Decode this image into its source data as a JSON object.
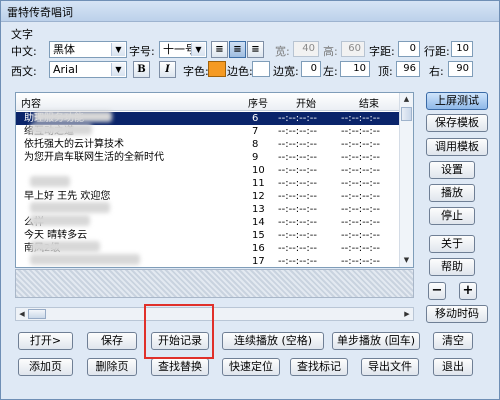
{
  "window": {
    "title": "雷特传奇唱词"
  },
  "font_section": {
    "label": "文字",
    "chinese_label": "中文:",
    "chinese_font": "黑体",
    "size_label": "字号:",
    "size_value": "十一号",
    "western_label": "西文:",
    "western_font": "Arial",
    "bold_label": "B",
    "italic_label": "I",
    "color_label": "字色:",
    "color_value": "#f59a23",
    "border_color_label": "边色:",
    "border_color_value": "#ffffff"
  },
  "params": {
    "width_label": "宽:",
    "width_value": "40",
    "height_label": "高:",
    "height_value": "60",
    "char_spacing_label": "字距:",
    "char_spacing_value": "0",
    "line_spacing_label": "行距:",
    "line_spacing_value": "10",
    "border_width_label": "边宽:",
    "border_width_value": "0",
    "left_label": "左:",
    "left_value": "10",
    "top_label": "顶:",
    "top_value": "96",
    "right_label": "右:",
    "right_value": "90"
  },
  "list": {
    "headers": {
      "content": "内容",
      "index": "序号",
      "start": "开始",
      "end": "结束"
    },
    "rows": [
      {
        "content": "助理服务功能",
        "index": "6",
        "start": "--:--:--:--",
        "end": "--:--:--:--",
        "selected": true
      },
      {
        "content": "络互动之道",
        "index": "7",
        "start": "--:--:--:--",
        "end": "--:--:--:--"
      },
      {
        "content": "依托强大的云计算技术",
        "index": "8",
        "start": "--:--:--:--",
        "end": "--:--:--:--"
      },
      {
        "content": "为您开启车联网生活的全新时代",
        "index": "9",
        "start": "--:--:--:--",
        "end": "--:--:--:--"
      },
      {
        "content": "",
        "index": "10",
        "start": "--:--:--:--",
        "end": "--:--:--:--"
      },
      {
        "content": "",
        "index": "11",
        "start": "--:--:--:--",
        "end": "--:--:--:--"
      },
      {
        "content": "早上好 王先  欢迎您",
        "index": "12",
        "start": "--:--:--:--",
        "end": "--:--:--:--"
      },
      {
        "content": "",
        "index": "13",
        "start": "--:--:--:--",
        "end": "--:--:--:--"
      },
      {
        "content": "么样",
        "index": "14",
        "start": "--:--:--:--",
        "end": "--:--:--:--"
      },
      {
        "content": "今天 晴转多云",
        "index": "15",
        "start": "--:--:--:--",
        "end": "--:--:--:--"
      },
      {
        "content": "南风2级",
        "index": "16",
        "start": "--:--:--:--",
        "end": "--:--:--:--"
      },
      {
        "content": "",
        "index": "17",
        "start": "--:--:--:--",
        "end": "--:--:--:--"
      },
      {
        "content": "论",
        "index": "18",
        "start": "--:--:--:--",
        "end": "--:--:--:--"
      }
    ]
  },
  "side_buttons": {
    "go_live": "上屏测试",
    "save_template": "保存模板",
    "load_template": "调用模板",
    "settings": "设置",
    "play": "播放",
    "stop": "停止",
    "about": "关于",
    "help": "帮助",
    "minus": "−",
    "plus": "+",
    "shift_time": "移动时码",
    "clear": "清空"
  },
  "bottom_buttons": {
    "open": "打开>",
    "save": "保存",
    "start_record": "开始记录",
    "continuous_play": "连续播放 (空格)",
    "single_play": "单步播放 (回车)",
    "add_page": "添加页",
    "delete_page": "删除页",
    "find_replace": "查找替换",
    "quick_locate": "快速定位",
    "find_mark": "查找标记",
    "export": "导出文件",
    "exit": "退出"
  },
  "colors": {
    "selection": "#0a246a",
    "highlight_box": "#e0302a"
  }
}
